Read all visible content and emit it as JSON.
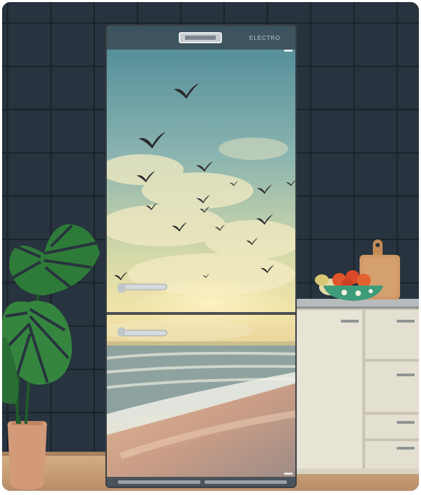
{
  "scene": {
    "subject": "fridge-with-seaside-wrap",
    "brand_text": "ELECTRO",
    "colors": {
      "tile_wall": "#26323d",
      "grout": "#1a2229",
      "floor": "#c8a27c",
      "cabinet": "#e6e2d4",
      "counter": "#b9bcbc",
      "sky_top": "#4d8a98",
      "sky_mid": "#b8c9a8",
      "horizon": "#f0e2a8",
      "sea": "#8aa0a2",
      "sand": "#d7a98a",
      "leaf": "#2f7a3a",
      "pot": "#d49a7a",
      "board": "#c98e5e",
      "bowl": "#3e9c7a",
      "fruit": "#e0552b"
    },
    "icons": [
      "gull-icon",
      "monstera-leaf-icon",
      "fridge-handle-icon",
      "cutting-board-icon",
      "fruit-bowl-icon",
      "cabinet-handle-icon"
    ]
  }
}
